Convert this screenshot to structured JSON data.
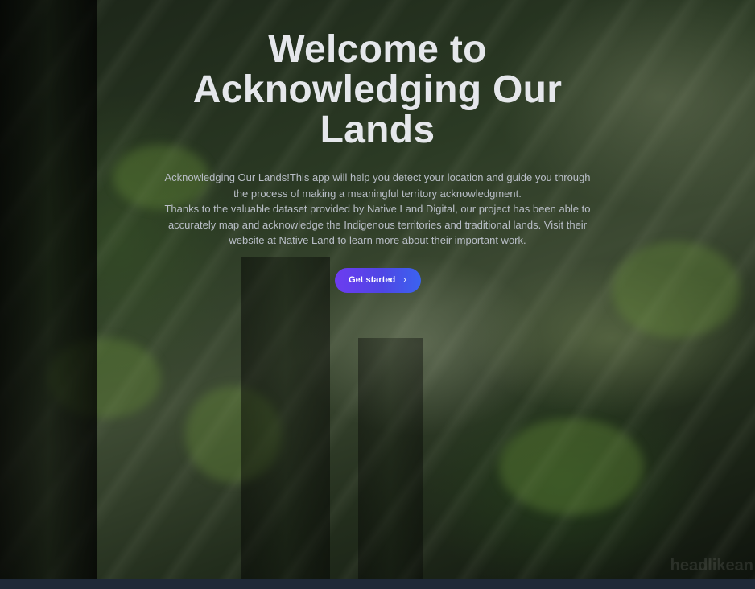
{
  "hero": {
    "title": "Welcome to Acknowledging Our Lands",
    "description_line1": "Acknowledging Our Lands!This app will help you detect your location and guide you through the process of making a meaningful territory acknowledgment.",
    "description_line2": "Thanks to the valuable dataset provided by Native Land Digital, our project has been able to accurately map and acknowledge the Indigenous territories and traditional lands. Visit their website at Native Land to learn more about their important work.",
    "cta_label": "Get started",
    "cta_icon": "chevron-right-icon",
    "watermark": "headlikean"
  },
  "colors": {
    "title": "#e5e7eb",
    "description": "#b9bec7",
    "cta_gradient_start": "#6d3cf0",
    "cta_gradient_end": "#3b63f0",
    "footer": "#1f2937"
  }
}
